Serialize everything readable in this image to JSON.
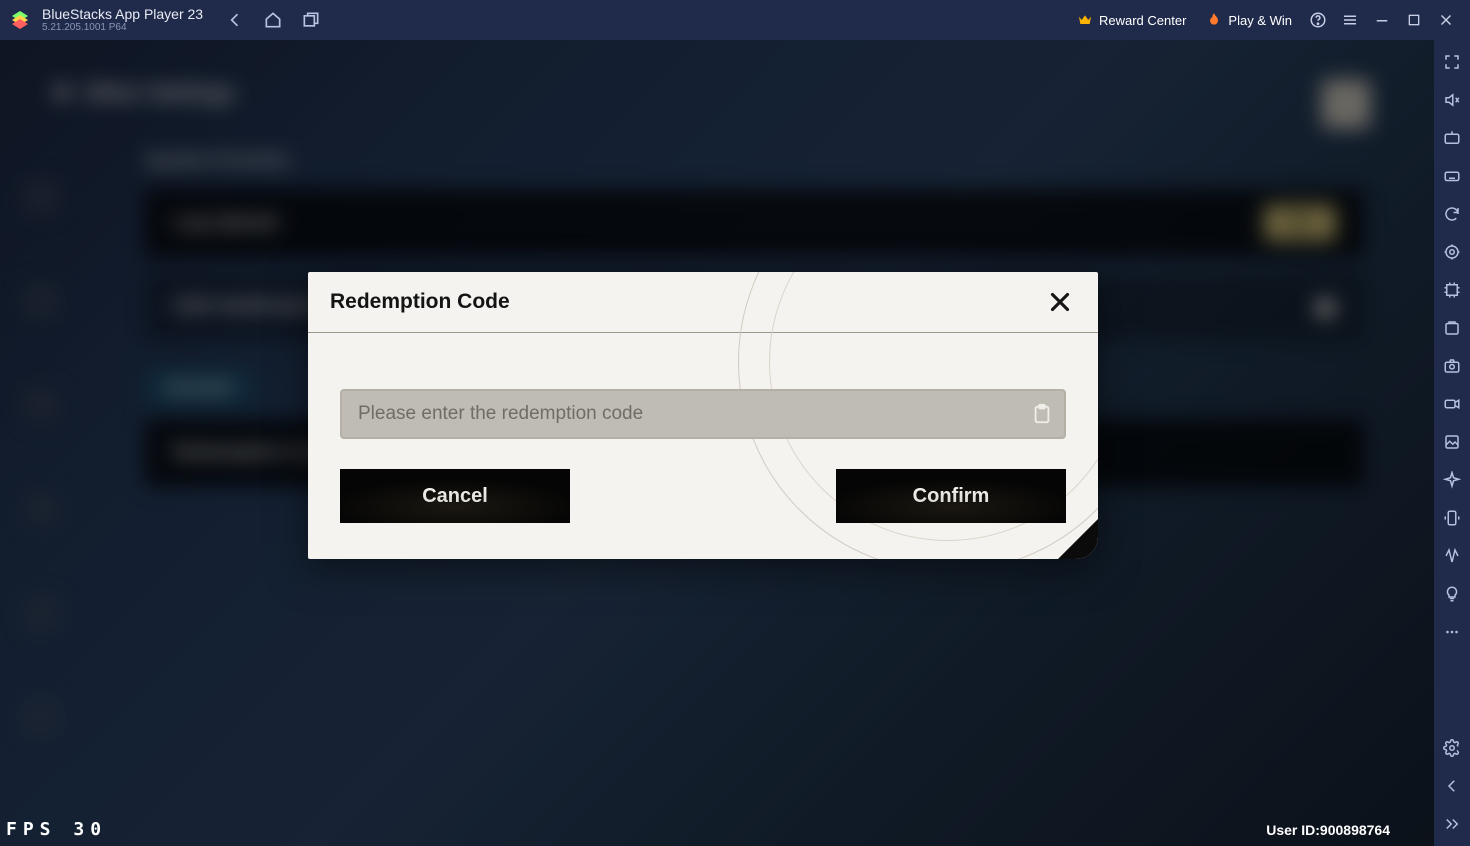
{
  "titlebar": {
    "app_name": "BlueStacks App Player 23",
    "version": "5.21.205.1001  P64",
    "reward_label": "Reward Center",
    "play_label": "Play & Win"
  },
  "game_bg": {
    "header": "Other Settings",
    "section": "System Function",
    "rows": {
      "log_upload": "Log Upload",
      "log_btn": "Go",
      "cdk": "CDK Notification",
      "redemption": "Redemption Code"
    },
    "tab": "Account"
  },
  "modal": {
    "title": "Redemption Code",
    "placeholder": "Please enter the redemption code",
    "cancel": "Cancel",
    "confirm": "Confirm"
  },
  "footer": {
    "fps_label": "FPS",
    "fps_value": "30",
    "user_id_label": "User ID:",
    "user_id_value": "900898764"
  }
}
